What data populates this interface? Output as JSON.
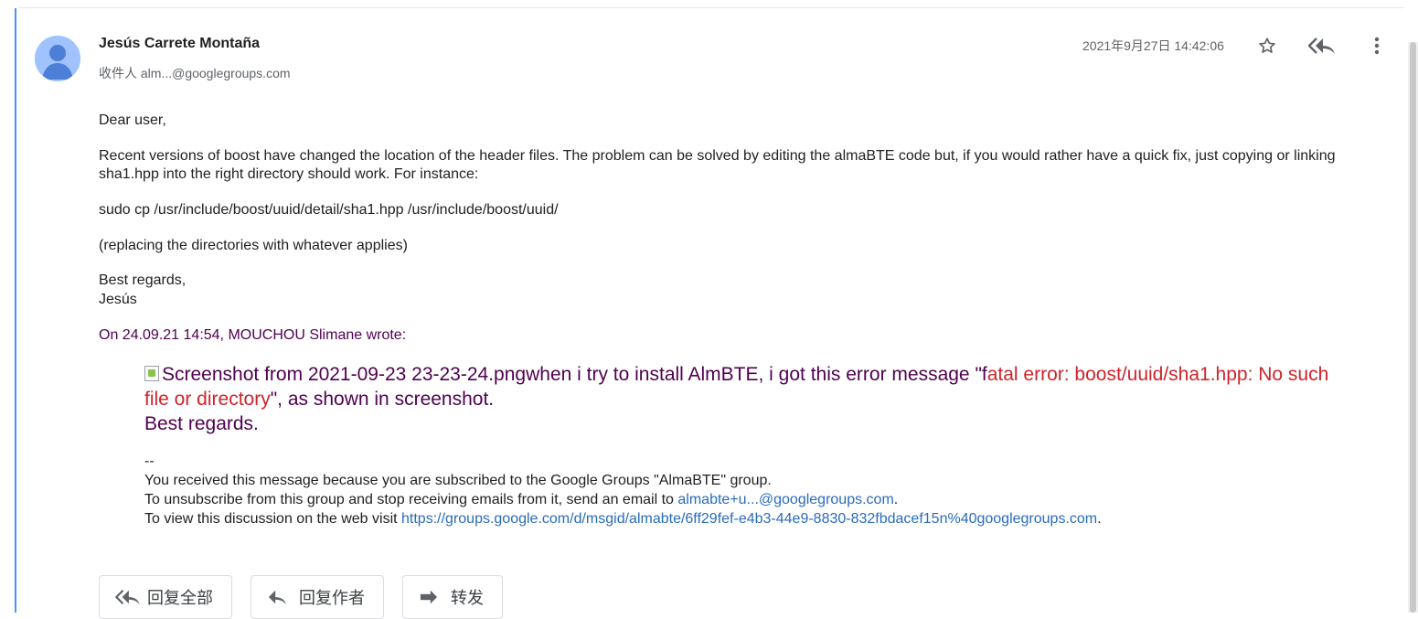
{
  "email": {
    "sender_name": "Jesús Carrete Montaña",
    "recipient_line": "收件人 alm...@googlegroups.com",
    "timestamp": "2021年9月27日 14:42:06"
  },
  "body": {
    "greeting": "Dear user,",
    "paragraph_main": "Recent versions of boost  have changed the location of the header files. The problem can be solved by editing the almaBTE code but, if you would rather have a quick fix, just copying or linking sha1.hpp into the right directory should work. For instance:",
    "command": "sudo cp /usr/include/boost/uuid/detail/sha1.hpp /usr/include/boost/uuid/",
    "replacing_note": "(replacing the directories with whatever applies)",
    "regards": "Best regards,",
    "signature": "Jesús",
    "attribution": "On 24.09.21 14:54, MOUCHOU Slimane wrote:"
  },
  "quote": {
    "image_alt": "Screenshot from 2021-09-23 23-23-24.png",
    "text_before": "when i try to install AlmBTE, i got this error message \"f",
    "error_text": "atal error: boost/uuid/sha1.hpp: No such file or directory",
    "text_after": "\", as shown in screenshot.",
    "regards": "Best regards."
  },
  "footer": {
    "separator": "--",
    "line1": "You received this message because you are subscribed to the Google Groups \"AlmaBTE\" group.",
    "line2_prefix": "To unsubscribe from this group and stop receiving emails from it, send an email to ",
    "unsubscribe_link": "almabte+u...@googlegroups.com",
    "line2_suffix": ".",
    "line3_prefix": "To view this discussion on the web visit ",
    "discussion_link": "https://groups.google.com/d/msgid/almabte/6ff29fef-e4b3-44e9-8830-832fbdacef15n%40googlegroups.com",
    "line3_suffix": "."
  },
  "actions": {
    "reply_all": "回复全部",
    "reply": "回复作者",
    "forward": "转发"
  },
  "icons": {
    "avatar": "person-avatar-icon",
    "star": "star-outline-icon",
    "reply_all": "reply-all-icon",
    "more": "more-vert-icon",
    "forward": "forward-icon"
  },
  "colors": {
    "accent_bar": "#4d90fe",
    "quote_text": "#500050",
    "error_text": "#d0232b",
    "link": "#1a73e8"
  }
}
